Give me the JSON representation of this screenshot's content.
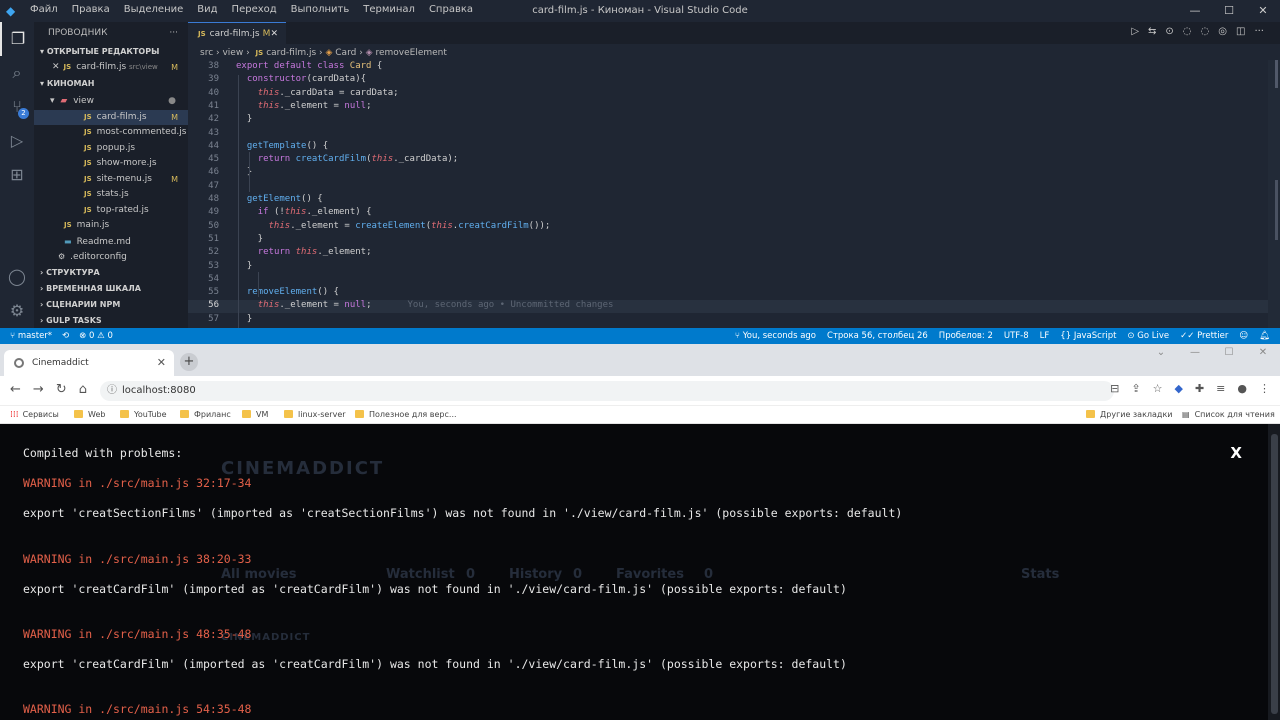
{
  "vscode": {
    "menu": [
      "Файл",
      "Правка",
      "Выделение",
      "Вид",
      "Переход",
      "Выполнить",
      "Терминал",
      "Справка"
    ],
    "window_title": "card-film.js - Киноман - Visual Studio Code",
    "explorer_label": "ПРОВОДНИК",
    "open_editors_label": "ОТКРЫТЫЕ РЕДАКТОРЫ",
    "open_editor_item": {
      "name": "card-film.js",
      "path": "src\\view",
      "mark": "M"
    },
    "project_label": "КИНОМАН",
    "folder_view": "view",
    "files": [
      {
        "name": "card-film.js",
        "mark": "M",
        "selected": true
      },
      {
        "name": "most-commented.js",
        "mark": ""
      },
      {
        "name": "popup.js",
        "mark": ""
      },
      {
        "name": "show-more.js",
        "mark": ""
      },
      {
        "name": "site-menu.js",
        "mark": "M"
      },
      {
        "name": "stats.js",
        "mark": ""
      },
      {
        "name": "top-rated.js",
        "mark": ""
      }
    ],
    "root_files": [
      "main.js",
      "Readme.md",
      ".editorconfig"
    ],
    "sections": [
      "СТРУКТУРА",
      "ВРЕМЕННАЯ ШКАЛА",
      "СЦЕНАРИИ NPM",
      "GULP TASKS"
    ],
    "scm_badge": "2",
    "tab": {
      "label": "card-film.js",
      "mark": "M"
    },
    "breadcrumb": [
      "src",
      "view",
      "card-film.js",
      "Card",
      "removeElement"
    ],
    "code": [
      {
        "n": "38",
        "html": "<span class='kw'>export default class</span> <span class='cls'>Card</span> {"
      },
      {
        "n": "39",
        "html": "  <span class='kw'>constructor</span>(cardData){"
      },
      {
        "n": "40",
        "html": "    <span class='th'>this</span>._cardData = cardData;"
      },
      {
        "n": "41",
        "html": "    <span class='th'>this</span>._element = <span class='kw'>null</span>;"
      },
      {
        "n": "42",
        "html": "  }"
      },
      {
        "n": "43",
        "html": ""
      },
      {
        "n": "44",
        "html": "  <span class='fn'>getTemplate</span>() {"
      },
      {
        "n": "45",
        "html": "    <span class='kw'>return</span> <span class='fn'>creatCardFilm</span>(<span class='th'>this</span>._cardData);"
      },
      {
        "n": "46",
        "html": "  }"
      },
      {
        "n": "47",
        "html": ""
      },
      {
        "n": "48",
        "html": "  <span class='fn'>getElement</span>() {"
      },
      {
        "n": "49",
        "html": "    <span class='kw'>if</span> (!<span class='th'>this</span>._element) {"
      },
      {
        "n": "50",
        "html": "      <span class='th'>this</span>._element = <span class='fn'>createElement</span>(<span class='th'>this</span>.<span class='fn'>creatCardFilm</span>());"
      },
      {
        "n": "51",
        "html": "    }"
      },
      {
        "n": "52",
        "html": "    <span class='kw'>return</span> <span class='th'>this</span>._element;"
      },
      {
        "n": "53",
        "html": "  }"
      },
      {
        "n": "54",
        "html": ""
      },
      {
        "n": "55",
        "html": "  <span class='fn'>removeElement</span>() {"
      },
      {
        "n": "56",
        "html": "    <span class='th'>this</span>._element = <span class='kw'>null</span>;<span class='ghost'>You, seconds ago • Uncommitted changes</span>"
      },
      {
        "n": "57",
        "html": "  }"
      }
    ],
    "status": {
      "branch": "master*",
      "errors": "0",
      "warnings": "0",
      "blame": "You, seconds ago",
      "position": "Строка 56, столбец 26",
      "indent": "Пробелов: 2",
      "encoding": "UTF-8",
      "eol": "LF",
      "language": "JavaScript",
      "golive": "Go Live",
      "prettier": "Prettier"
    }
  },
  "browser": {
    "tab_title": "Cinemaddict",
    "url": "localhost:8080",
    "bookmarks": [
      "Сервисы",
      "Web",
      "YouTube",
      "Фриланс",
      "VM",
      "linux-server",
      "Полезное для верс...",
      "Другие закладки",
      "Список для чтения"
    ]
  },
  "page": {
    "bg_logo": "CINEMADDICT",
    "bg_nav": [
      "All movies",
      "Watchlist",
      "0",
      "History",
      "0",
      "Favorites",
      "0",
      "Stats"
    ],
    "bg_logo2": "CINEMADDICT",
    "overlay_title": "Compiled with problems:",
    "close": "X",
    "messages": [
      {
        "warning": "WARNING in ./src/main.js 32:17-34",
        "text": "export 'creatSectionFilms' (imported as 'creatSectionFilms') was not found in './view/card-film.js' (possible exports: default)"
      },
      {
        "warning": "WARNING in ./src/main.js 38:20-33",
        "text": "export 'creatCardFilm' (imported as 'creatCardFilm') was not found in './view/card-film.js' (possible exports: default)"
      },
      {
        "warning": "WARNING in ./src/main.js 48:35-48",
        "text": "export 'creatCardFilm' (imported as 'creatCardFilm') was not found in './view/card-film.js' (possible exports: default)"
      },
      {
        "warning": "WARNING in ./src/main.js 54:35-48",
        "text": ""
      }
    ]
  }
}
